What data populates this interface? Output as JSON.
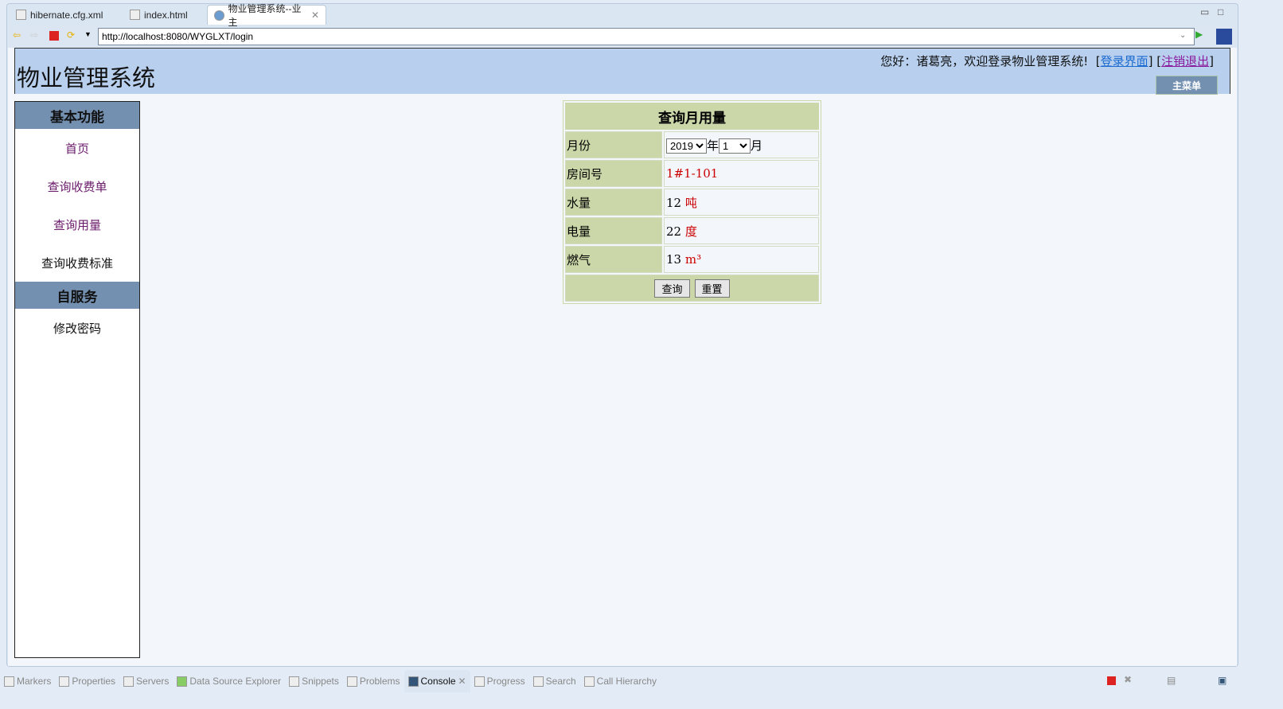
{
  "editor_tabs": [
    {
      "label": "hibernate.cfg.xml",
      "icon": "xml-file-icon"
    },
    {
      "label": "index.html",
      "icon": "html-file-icon"
    },
    {
      "label": "物业管理系统--业主",
      "icon": "globe-icon",
      "active": true
    }
  ],
  "browser": {
    "url": "http://localhost:8080/WYGLXT/login"
  },
  "header": {
    "title": "物业管理系统",
    "welcome": "您好：诸葛亮，欢迎登录物业管理系统!",
    "login_link": "登录界面",
    "logout_link": "注销退出",
    "main_menu": "主菜单"
  },
  "sidebar": {
    "section1": "基本功能",
    "items1": [
      "首页",
      "查询收费单",
      "查询用量",
      "查询收费标准"
    ],
    "section2": "自服务",
    "items2": [
      "修改密码"
    ]
  },
  "form": {
    "title": "查询月用量",
    "month_label": "月份",
    "year": "2019",
    "year_suffix": "年",
    "month": "1",
    "month_suffix": "月",
    "room_label": "房间号",
    "room": "1#1-101",
    "water_label": "水量",
    "water": "12",
    "water_unit": "吨",
    "power_label": "电量",
    "power": "22",
    "power_unit": "度",
    "gas_label": "燃气",
    "gas": "13",
    "gas_unit": "m³",
    "query": "查询",
    "reset": "重置"
  },
  "bottom_tabs": [
    "Markers",
    "Properties",
    "Servers",
    "Data Source Explorer",
    "Snippets",
    "Problems",
    "Console",
    "Progress",
    "Search",
    "Call Hierarchy"
  ],
  "colors": {
    "header": "#b8d0ee",
    "sidebar_head": "#7390b1",
    "form_label": "#cbd7a9",
    "red": "#cc0000"
  }
}
